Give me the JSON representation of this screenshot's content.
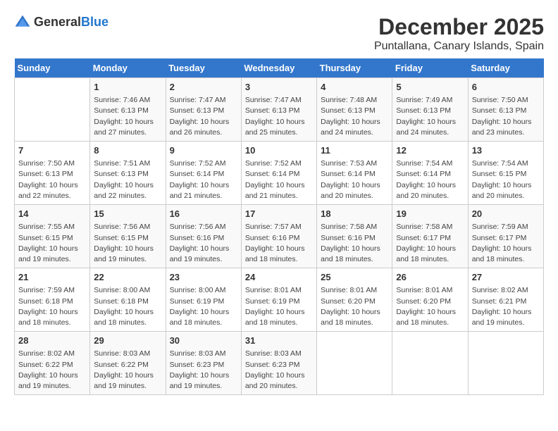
{
  "logo": {
    "text_general": "General",
    "text_blue": "Blue"
  },
  "title": "December 2025",
  "location": "Puntallana, Canary Islands, Spain",
  "headers": [
    "Sunday",
    "Monday",
    "Tuesday",
    "Wednesday",
    "Thursday",
    "Friday",
    "Saturday"
  ],
  "weeks": [
    [
      {
        "day": "",
        "content": ""
      },
      {
        "day": "1",
        "content": "Sunrise: 7:46 AM\nSunset: 6:13 PM\nDaylight: 10 hours\nand 27 minutes."
      },
      {
        "day": "2",
        "content": "Sunrise: 7:47 AM\nSunset: 6:13 PM\nDaylight: 10 hours\nand 26 minutes."
      },
      {
        "day": "3",
        "content": "Sunrise: 7:47 AM\nSunset: 6:13 PM\nDaylight: 10 hours\nand 25 minutes."
      },
      {
        "day": "4",
        "content": "Sunrise: 7:48 AM\nSunset: 6:13 PM\nDaylight: 10 hours\nand 24 minutes."
      },
      {
        "day": "5",
        "content": "Sunrise: 7:49 AM\nSunset: 6:13 PM\nDaylight: 10 hours\nand 24 minutes."
      },
      {
        "day": "6",
        "content": "Sunrise: 7:50 AM\nSunset: 6:13 PM\nDaylight: 10 hours\nand 23 minutes."
      }
    ],
    [
      {
        "day": "7",
        "content": "Sunrise: 7:50 AM\nSunset: 6:13 PM\nDaylight: 10 hours\nand 22 minutes."
      },
      {
        "day": "8",
        "content": "Sunrise: 7:51 AM\nSunset: 6:13 PM\nDaylight: 10 hours\nand 22 minutes."
      },
      {
        "day": "9",
        "content": "Sunrise: 7:52 AM\nSunset: 6:14 PM\nDaylight: 10 hours\nand 21 minutes."
      },
      {
        "day": "10",
        "content": "Sunrise: 7:52 AM\nSunset: 6:14 PM\nDaylight: 10 hours\nand 21 minutes."
      },
      {
        "day": "11",
        "content": "Sunrise: 7:53 AM\nSunset: 6:14 PM\nDaylight: 10 hours\nand 20 minutes."
      },
      {
        "day": "12",
        "content": "Sunrise: 7:54 AM\nSunset: 6:14 PM\nDaylight: 10 hours\nand 20 minutes."
      },
      {
        "day": "13",
        "content": "Sunrise: 7:54 AM\nSunset: 6:15 PM\nDaylight: 10 hours\nand 20 minutes."
      }
    ],
    [
      {
        "day": "14",
        "content": "Sunrise: 7:55 AM\nSunset: 6:15 PM\nDaylight: 10 hours\nand 19 minutes."
      },
      {
        "day": "15",
        "content": "Sunrise: 7:56 AM\nSunset: 6:15 PM\nDaylight: 10 hours\nand 19 minutes."
      },
      {
        "day": "16",
        "content": "Sunrise: 7:56 AM\nSunset: 6:16 PM\nDaylight: 10 hours\nand 19 minutes."
      },
      {
        "day": "17",
        "content": "Sunrise: 7:57 AM\nSunset: 6:16 PM\nDaylight: 10 hours\nand 18 minutes."
      },
      {
        "day": "18",
        "content": "Sunrise: 7:58 AM\nSunset: 6:16 PM\nDaylight: 10 hours\nand 18 minutes."
      },
      {
        "day": "19",
        "content": "Sunrise: 7:58 AM\nSunset: 6:17 PM\nDaylight: 10 hours\nand 18 minutes."
      },
      {
        "day": "20",
        "content": "Sunrise: 7:59 AM\nSunset: 6:17 PM\nDaylight: 10 hours\nand 18 minutes."
      }
    ],
    [
      {
        "day": "21",
        "content": "Sunrise: 7:59 AM\nSunset: 6:18 PM\nDaylight: 10 hours\nand 18 minutes."
      },
      {
        "day": "22",
        "content": "Sunrise: 8:00 AM\nSunset: 6:18 PM\nDaylight: 10 hours\nand 18 minutes."
      },
      {
        "day": "23",
        "content": "Sunrise: 8:00 AM\nSunset: 6:19 PM\nDaylight: 10 hours\nand 18 minutes."
      },
      {
        "day": "24",
        "content": "Sunrise: 8:01 AM\nSunset: 6:19 PM\nDaylight: 10 hours\nand 18 minutes."
      },
      {
        "day": "25",
        "content": "Sunrise: 8:01 AM\nSunset: 6:20 PM\nDaylight: 10 hours\nand 18 minutes."
      },
      {
        "day": "26",
        "content": "Sunrise: 8:01 AM\nSunset: 6:20 PM\nDaylight: 10 hours\nand 18 minutes."
      },
      {
        "day": "27",
        "content": "Sunrise: 8:02 AM\nSunset: 6:21 PM\nDaylight: 10 hours\nand 19 minutes."
      }
    ],
    [
      {
        "day": "28",
        "content": "Sunrise: 8:02 AM\nSunset: 6:22 PM\nDaylight: 10 hours\nand 19 minutes."
      },
      {
        "day": "29",
        "content": "Sunrise: 8:03 AM\nSunset: 6:22 PM\nDaylight: 10 hours\nand 19 minutes."
      },
      {
        "day": "30",
        "content": "Sunrise: 8:03 AM\nSunset: 6:23 PM\nDaylight: 10 hours\nand 19 minutes."
      },
      {
        "day": "31",
        "content": "Sunrise: 8:03 AM\nSunset: 6:23 PM\nDaylight: 10 hours\nand 20 minutes."
      },
      {
        "day": "",
        "content": ""
      },
      {
        "day": "",
        "content": ""
      },
      {
        "day": "",
        "content": ""
      }
    ]
  ]
}
